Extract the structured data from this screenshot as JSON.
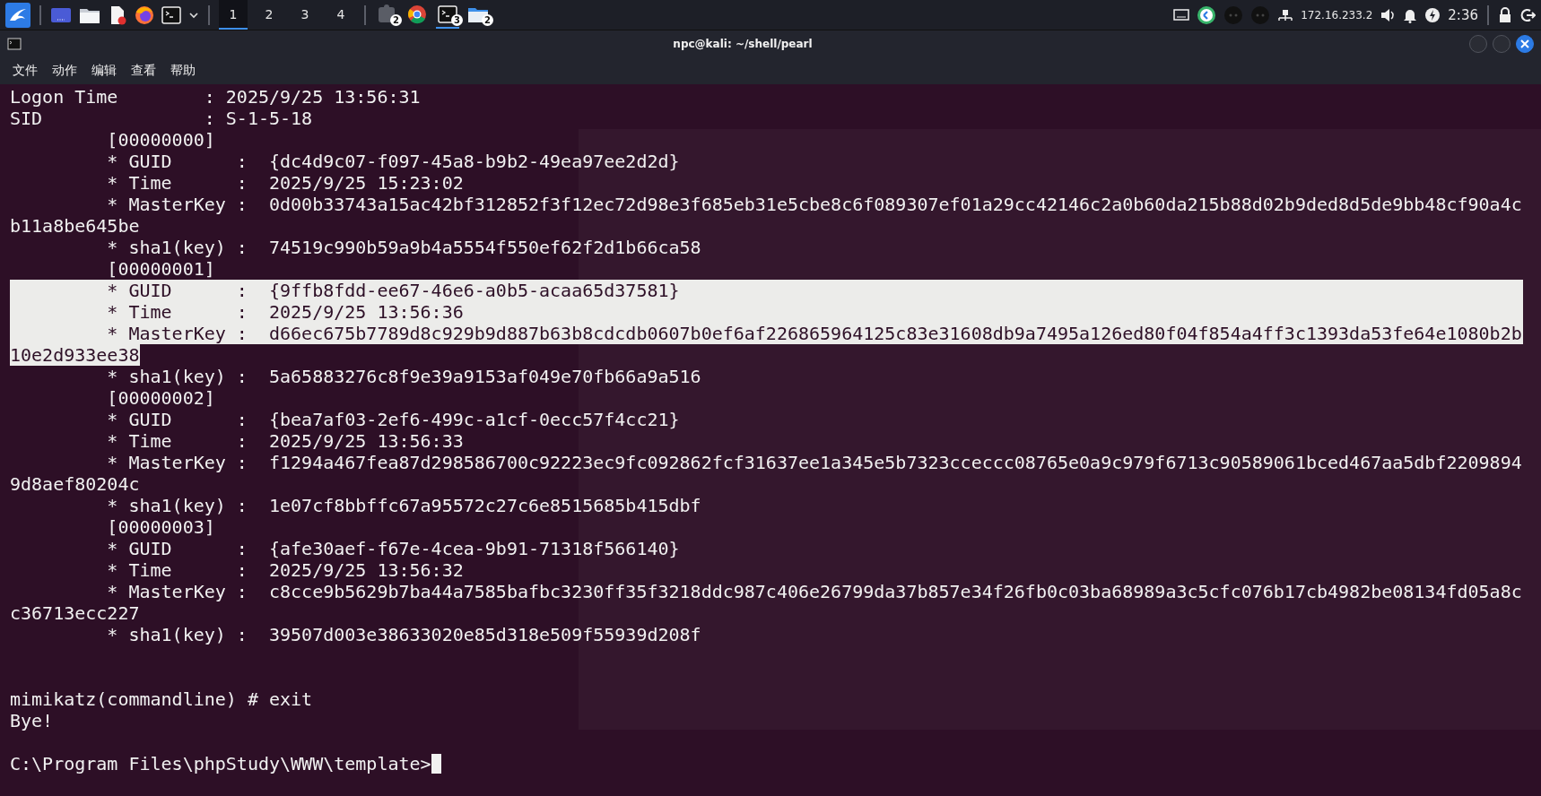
{
  "taskbar": {
    "workspaces": [
      {
        "label": "1",
        "selected": true
      },
      {
        "label": "2",
        "selected": false
      },
      {
        "label": "3",
        "selected": false
      },
      {
        "label": "4",
        "selected": false
      }
    ],
    "tasks": [
      {
        "kind": "app",
        "badge": "2",
        "selected": false
      },
      {
        "kind": "browser",
        "selected": false
      },
      {
        "kind": "terminal",
        "badge": "3",
        "selected": true
      },
      {
        "kind": "files",
        "badge": "2",
        "selected": false
      }
    ],
    "ip": "172.16.233.2",
    "clock": "2:36"
  },
  "window": {
    "title": "npc@kali: ~/shell/pearl",
    "menu": [
      "文件",
      "动作",
      "编辑",
      "查看",
      "帮助"
    ]
  },
  "terminal": {
    "lines": [
      {
        "text": "Logon Time        : 2025/9/25 13:56:31",
        "selected": false
      },
      {
        "text": "SID               : S-1-5-18",
        "selected": false
      },
      {
        "text": "         [00000000]",
        "selected": false
      },
      {
        "text": "         * GUID      :  {dc4d9c07-f097-45a8-b9b2-49ea97ee2d2d}",
        "selected": false
      },
      {
        "text": "         * Time      :  2025/9/25 15:23:02",
        "selected": false
      },
      {
        "text": "         * MasterKey :  0d00b33743a15ac42bf312852f3f12ec72d98e3f685eb31e5cbe8c6f089307ef01a29cc42146c2a0b60da215b88d02b9ded8d5de9bb48cf90a4c",
        "selected": false
      },
      {
        "text": "b11a8be645be",
        "selected": false
      },
      {
        "text": "         * sha1(key) :  74519c990b59a9b4a5554f550ef62f2d1b66ca58",
        "selected": false
      },
      {
        "text": "         [00000001]",
        "selected": false
      },
      {
        "text": "         * GUID      :  {9ffb8fdd-ee67-46e6-a0b5-acaa65d37581}",
        "selected": true
      },
      {
        "text": "         * Time      :  2025/9/25 13:56:36",
        "selected": true
      },
      {
        "text": "         * MasterKey :  d66ec675b7789d8c929b9d887b63b8cdcdb0607b0ef6af226865964125c83e31608db9a7495a126ed80f04f854a4ff3c1393da53fe64e1080b2b",
        "selected": true
      },
      {
        "text": "10e2d933ee38",
        "selected": true
      },
      {
        "text": "         * sha1(key) :  5a65883276c8f9e39a9153af049e70fb66a9a516",
        "selected": false
      },
      {
        "text": "         [00000002]",
        "selected": false
      },
      {
        "text": "         * GUID      :  {bea7af03-2ef6-499c-a1cf-0ecc57f4cc21}",
        "selected": false
      },
      {
        "text": "         * Time      :  2025/9/25 13:56:33",
        "selected": false
      },
      {
        "text": "         * MasterKey :  f1294a467fea87d298586700c92223ec9fc092862fcf31637ee1a345e5b7323cceccc08765e0a9c979f6713c90589061bced467aa5dbf2209894",
        "selected": false
      },
      {
        "text": "9d8aef80204c",
        "selected": false
      },
      {
        "text": "         * sha1(key) :  1e07cf8bbffc67a95572c27c6e8515685b415dbf",
        "selected": false
      },
      {
        "text": "         [00000003]",
        "selected": false
      },
      {
        "text": "         * GUID      :  {afe30aef-f67e-4cea-9b91-71318f566140}",
        "selected": false
      },
      {
        "text": "         * Time      :  2025/9/25 13:56:32",
        "selected": false
      },
      {
        "text": "         * MasterKey :  c8cce9b5629b7ba44a7585bafbc3230ff35f3218ddc987c406e26799da37b857e34f26fb0c03ba68989a3c5cfc076b17cb4982be08134fd05a8c",
        "selected": false
      },
      {
        "text": "c36713ecc227",
        "selected": false
      },
      {
        "text": "         * sha1(key) :  39507d003e38633020e85d318e509f55939d208f",
        "selected": false
      }
    ],
    "session_end": [
      "mimikatz(commandline) # exit",
      "Bye!"
    ],
    "prompt": "C:\\Program Files\\phpStudy\\WWW\\template>"
  }
}
